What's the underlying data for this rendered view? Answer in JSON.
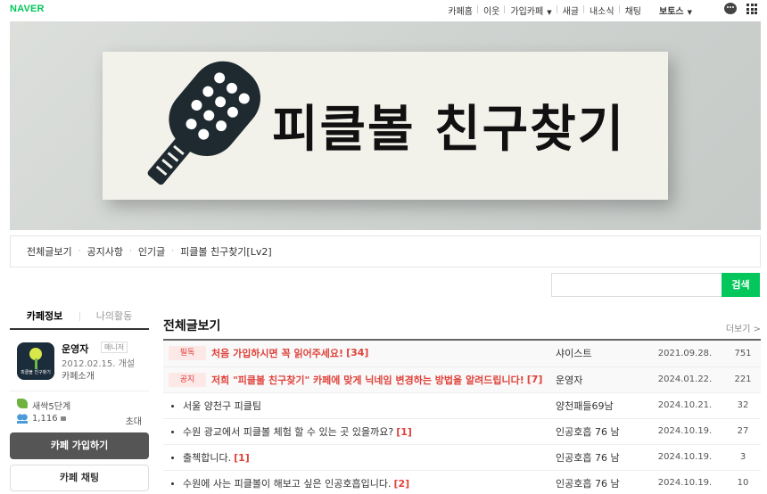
{
  "topbar": {
    "logo": "NAVER",
    "nav": [
      "카페홈",
      "이웃",
      "가입카페",
      "새글",
      "내소식",
      "채팅"
    ],
    "user": "보토스"
  },
  "banner": {
    "title": "피클볼 친구찾기"
  },
  "menu": [
    "전체글보기",
    "공지사항",
    "인기글",
    "피클볼 친구찾기[Lv2]"
  ],
  "search": {
    "placeholder": "",
    "button": "검색"
  },
  "sidebar": {
    "tabs": [
      "카페정보",
      "나의활동"
    ],
    "manager_name": "운영자",
    "manager_badge": "매니저",
    "founded": "2012.02.15. 개설",
    "intro_link": "카페소개",
    "thumb_caption": "피클볼 친구찾기",
    "level": "새싹5단계",
    "members": "1,116",
    "invite": "초대",
    "join_button": "카페 가입하기",
    "chat_button": "카페 채팅"
  },
  "board": {
    "title": "전체글보기",
    "more": "더보기 >",
    "rows": [
      {
        "tag": "필독",
        "title": "처음 가입하시면 꼭 읽어주세요!",
        "comments": "[34]",
        "author": "샤이스트",
        "date": "2021.09.28.",
        "views": "751",
        "notice": true
      },
      {
        "tag": "공지",
        "title": "저희 \"피클볼 친구찾기\" 카페에 맞게 닉네임 변경하는 방법을 알려드립니다!",
        "comments": "[7]",
        "author": "운영자",
        "date": "2024.01.22.",
        "views": "221",
        "notice": true
      },
      {
        "tag": "",
        "title": "서울 양천구 피클팀",
        "comments": "",
        "author": "양천패들69남",
        "date": "2024.10.21.",
        "views": "32",
        "notice": false
      },
      {
        "tag": "",
        "title": "수원 광교에서 피클볼 체험 할 수 있는 곳 있을까요?",
        "comments": "[1]",
        "author": "인공호흡 76 남",
        "date": "2024.10.19.",
        "views": "27",
        "notice": false
      },
      {
        "tag": "",
        "title": "출첵합니다.",
        "comments": "[1]",
        "author": "인공호흡 76 남",
        "date": "2024.10.19.",
        "views": "3",
        "notice": false
      },
      {
        "tag": "",
        "title": "수원에 사는 피클볼이 해보고 싶은 인공호흡입니다.",
        "comments": "[2]",
        "author": "인공호흡 76 남",
        "date": "2024.10.19.",
        "views": "10",
        "notice": false
      }
    ]
  },
  "colors": {
    "brand": "#03c75a",
    "notice": "#e0423b"
  }
}
